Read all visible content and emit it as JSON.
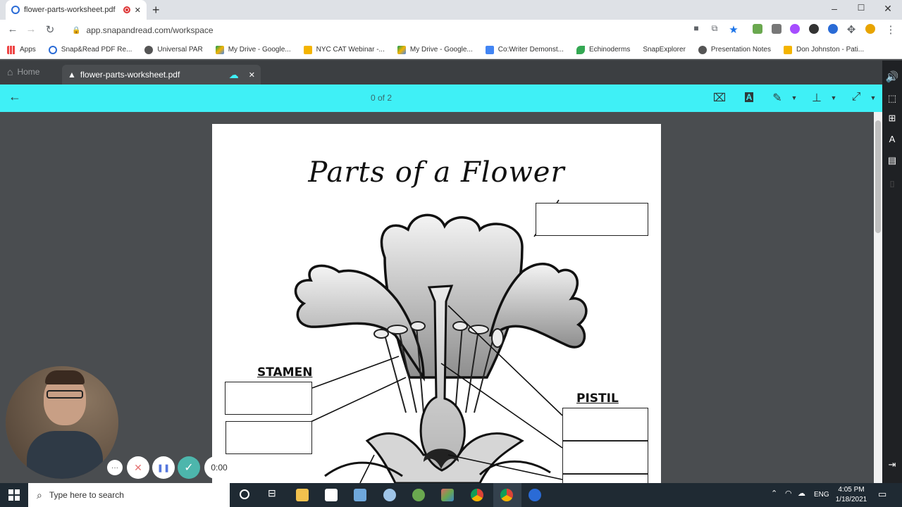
{
  "browser": {
    "tab_title": "flower-parts-worksheet.pdf",
    "url": "app.snapandread.com/workspace",
    "new_tab": "+",
    "window_controls": [
      "–",
      "☐",
      "✕"
    ]
  },
  "bookmarks": [
    {
      "label": "Apps",
      "color": "#e44"
    },
    {
      "label": "Snap&Read PDF Re...",
      "color": "#2a6bd6"
    },
    {
      "label": "Universal PAR",
      "color": "#444"
    },
    {
      "label": "My Drive - Google...",
      "color": "#f4b400"
    },
    {
      "label": "NYC CAT Webinar -...",
      "color": "#f4b400"
    },
    {
      "label": "My Drive - Google...",
      "color": "#f4b400"
    },
    {
      "label": "Co:Writer Demonst...",
      "color": "#4285f4"
    },
    {
      "label": "Echinoderms",
      "color": "#34a853"
    },
    {
      "label": "SnapExplorer",
      "color": "#fff"
    },
    {
      "label": "Presentation Notes",
      "color": "#444"
    },
    {
      "label": "Don Johnston - Pati...",
      "color": "#f4b400"
    }
  ],
  "app": {
    "home_label": "Home",
    "file_tab_label": "flower-parts-worksheet.pdf",
    "page_counter": "0  of  2",
    "accent": "#3ff0f6"
  },
  "document": {
    "title": "Parts of a Flower",
    "label_stamen": "STAMEN",
    "label_pistil": "PISTIL"
  },
  "recorder": {
    "timer": "0:00",
    "more": "···",
    "cancel": "✕",
    "pause": "❚❚",
    "done": "✓"
  },
  "taskbar": {
    "search_placeholder": "Type here to search",
    "language": "ENG",
    "time": "4:05 PM",
    "date": "1/18/2021"
  }
}
